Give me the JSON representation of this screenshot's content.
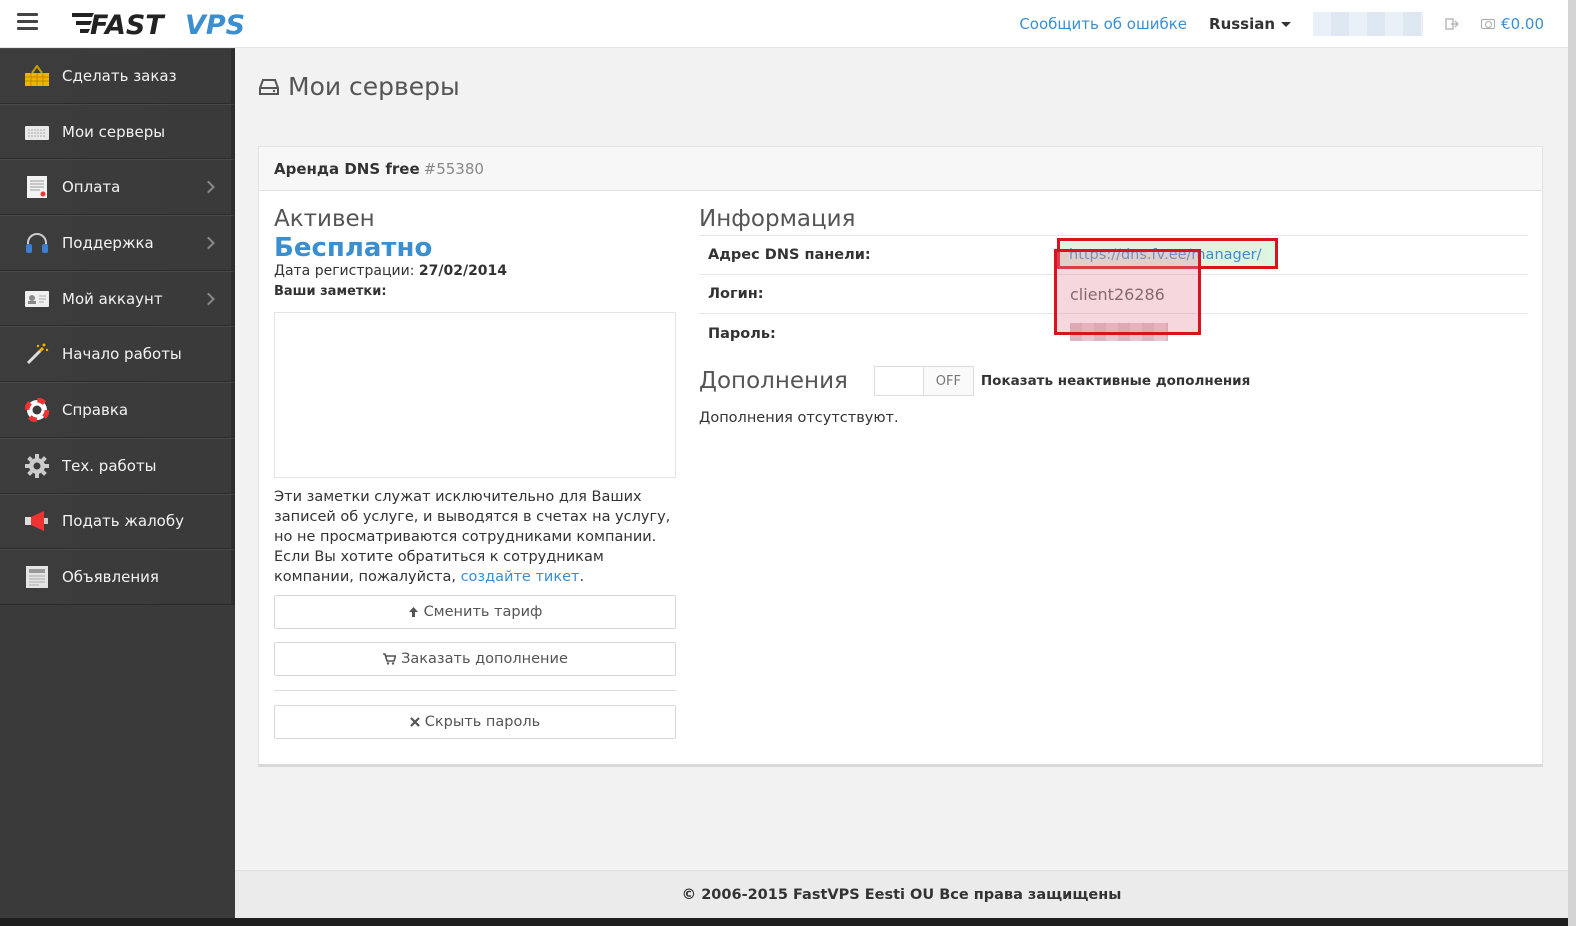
{
  "header": {
    "logo_text": "FASTVPS",
    "report_link": "Сообщить об ошибке",
    "language": "Russian",
    "balance": "€0.00"
  },
  "sidebar": {
    "items": [
      {
        "label": "Сделать заказ",
        "icon": "basket-icon",
        "has_submenu": false
      },
      {
        "label": "Мои серверы",
        "icon": "keyboard-icon",
        "has_submenu": false
      },
      {
        "label": "Оплата",
        "icon": "invoice-icon",
        "has_submenu": true
      },
      {
        "label": "Поддержка",
        "icon": "headphones-icon",
        "has_submenu": true
      },
      {
        "label": "Мой аккаунт",
        "icon": "id-card-icon",
        "has_submenu": true
      },
      {
        "label": "Начало работы",
        "icon": "magic-wand-icon",
        "has_submenu": false
      },
      {
        "label": "Справка",
        "icon": "lifebuoy-icon",
        "has_submenu": false
      },
      {
        "label": "Тех. работы",
        "icon": "gear-icon",
        "has_submenu": false
      },
      {
        "label": "Подать жалобу",
        "icon": "megaphone-icon",
        "has_submenu": false
      },
      {
        "label": "Объявления",
        "icon": "newspaper-icon",
        "has_submenu": false
      }
    ]
  },
  "page": {
    "title": "Мои серверы"
  },
  "service": {
    "name": "Аренда DNS free",
    "number": "#55380",
    "status": "Активен",
    "price": "Бесплатно",
    "reg_label": "Дата регистрации:",
    "reg_date": "27/02/2014",
    "notes_label": "Ваши заметки:",
    "notes_value": "",
    "notes_help": "Эти заметки служат исключительно для Ваших записей об услуге, и выводятся в счетах на услугу, но не просматриваются сотрудниками компании. Если Вы хотите обратиться к сотрудникам компании, пожалуйста, ",
    "notes_help_link": "создайте тикет",
    "notes_help_end": ".",
    "btn_change_tariff": "Сменить тариф",
    "btn_order_addon": "Заказать дополнение",
    "btn_hide_password": "Скрыть пароль"
  },
  "info": {
    "title": "Информация",
    "rows": [
      {
        "key": "Адрес DNS панели:",
        "value": "https://dns.fv.ee/manager/"
      },
      {
        "key": "Логин:",
        "value": "client26286"
      },
      {
        "key": "Пароль:",
        "value": ""
      }
    ]
  },
  "addons": {
    "title": "Дополнения",
    "toggle_state": "OFF",
    "toggle_label": "Показать неактивные дополнения",
    "empty_text": "Дополнения отсутствуют."
  },
  "footer": {
    "text": "© 2006-2015 FastVPS Eesti OU Все права защищены"
  },
  "colors": {
    "accent": "#3b8fd0",
    "sidebar_bg": "#3a3a3a",
    "highlight_border": "#d9121f"
  }
}
